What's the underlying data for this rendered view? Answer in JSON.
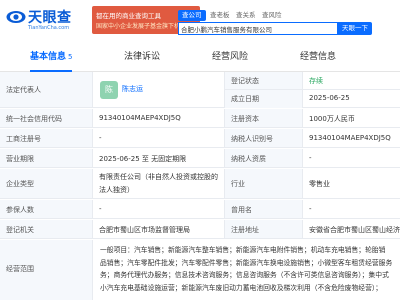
{
  "header": {
    "logo_text": "天眼查",
    "logo_sub": "TianYanCha.com",
    "banner_line1": "都在用的商业查询工具",
    "banner_line2": "国家中小企业发展子基金旗下机构",
    "search_tabs": [
      "查公司",
      "查老板",
      "查关系",
      "查风险"
    ],
    "search_value": "合肥小鹏汽车销售服务有限公司",
    "search_button": "天眼一下"
  },
  "tabs": [
    {
      "label": "基本信息",
      "count": "5"
    },
    {
      "label": "法律诉讼",
      "count": ""
    },
    {
      "label": "经营风险",
      "count": ""
    },
    {
      "label": "经营信息",
      "count": ""
    }
  ],
  "info": {
    "legal_rep_label": "法定代表人",
    "legal_rep_avatar": "陈",
    "legal_rep_name": "陈志运",
    "reg_status_label": "登记状态",
    "reg_status_value": "存续",
    "established_label": "成立日期",
    "established_value": "2025-06-25",
    "credit_code_label": "统一社会信用代码",
    "credit_code_value": "91340104MAEP4XDJ5Q",
    "reg_capital_label": "注册资本",
    "reg_capital_value": "1000万人民币",
    "biz_reg_no_label": "工商注册号",
    "biz_reg_no_value": "-",
    "taxpayer_id_label": "纳税人识别号",
    "taxpayer_id_value": "91340104MAEP4XDJ5Q",
    "term_label": "营业期限",
    "term_value": "2025-06-25 至 无固定期限",
    "taxpayer_qual_label": "纳税人资质",
    "taxpayer_qual_value": "-",
    "type_label": "企业类型",
    "type_value_l1": "有限责任公司（非自然人投资或控股的",
    "type_value_l2": "法人独资）",
    "industry_label": "行业",
    "industry_value": "零售业",
    "insured_label": "参保人数",
    "insured_value": "-",
    "former_name_label": "曾用名",
    "former_name_value": "-",
    "authority_label": "登记机关",
    "authority_value": "合肥市蜀山区市场监督管理局",
    "address_label": "注册地址",
    "address_value": "安徽省合肥市蜀山区蜀山经济",
    "scope_label": "经营范围",
    "scope_lines": [
      "一般项目：汽车销售；新能源汽车整车销售；新能源汽车电附件销售；机动车充电销售；轮胎销",
      "品销售；汽车零配件批发；汽车零配件零售；新能源汽车换电设施销售；小微型客车租赁经营服务",
      "务；商务代理代办服务；信息技术咨询服务；信息咨询服务（不含许可类信息咨询服务）；集中式",
      "小汽车充电基础设施运营；新能源汽车废旧动力蓄电池回收及梯次利用（不含危险废物经营）；"
    ]
  }
}
